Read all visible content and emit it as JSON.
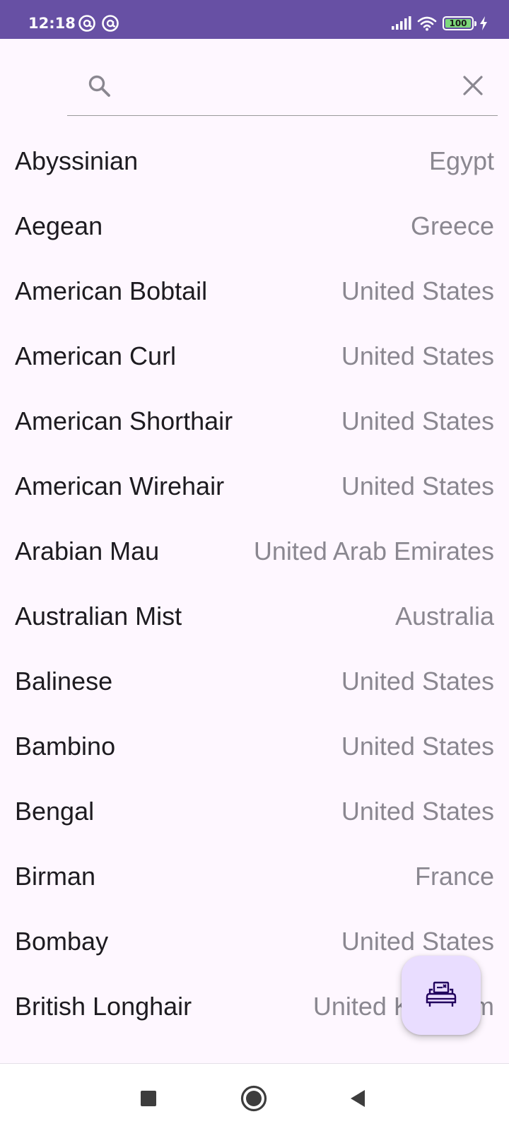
{
  "status_bar": {
    "time": "12:18",
    "battery": "100",
    "notification_icons": [
      "at-sign-circle-icon",
      "at-sign-circle-icon"
    ],
    "bg_color": "#6750a4"
  },
  "search": {
    "value": "",
    "placeholder": ""
  },
  "breeds": [
    {
      "name": "Abyssinian",
      "origin": "Egypt"
    },
    {
      "name": "Aegean",
      "origin": "Greece"
    },
    {
      "name": "American Bobtail",
      "origin": "United States"
    },
    {
      "name": "American Curl",
      "origin": "United States"
    },
    {
      "name": "American Shorthair",
      "origin": "United States"
    },
    {
      "name": "American Wirehair",
      "origin": "United States"
    },
    {
      "name": "Arabian Mau",
      "origin": "United Arab Emirates"
    },
    {
      "name": "Australian Mist",
      "origin": "Australia"
    },
    {
      "name": "Balinese",
      "origin": "United States"
    },
    {
      "name": "Bambino",
      "origin": "United States"
    },
    {
      "name": "Bengal",
      "origin": "United States"
    },
    {
      "name": "Birman",
      "origin": "France"
    },
    {
      "name": "Bombay",
      "origin": "United States"
    },
    {
      "name": "British Longhair",
      "origin": "United Kingdom"
    }
  ],
  "fab": {
    "icon": "sofa-edit-icon",
    "bg_color": "#e9ddff"
  },
  "navigation": {
    "buttons": [
      "recents-button",
      "home-button",
      "back-button"
    ]
  },
  "colors": {
    "background": "#fef7ff",
    "primary": "#6750a4",
    "text_primary": "#1d1b20",
    "text_secondary": "#8a8790"
  }
}
